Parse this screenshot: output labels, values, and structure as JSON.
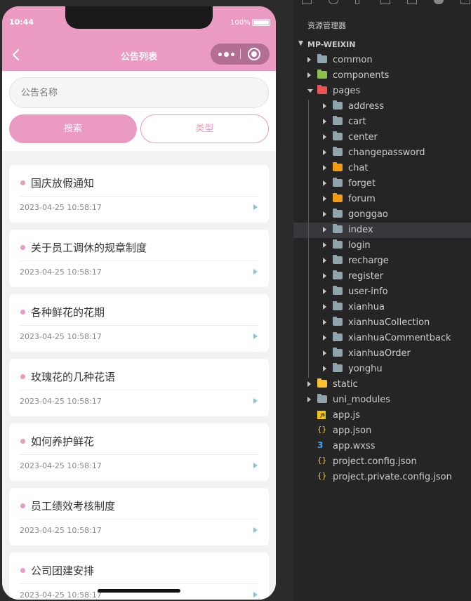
{
  "phone": {
    "status": {
      "time": "10:44",
      "battery": "100%"
    },
    "nav": {
      "title": "公告列表"
    },
    "search": {
      "placeholder": "公告名称",
      "search_label": "搜索",
      "type_label": "类型"
    },
    "notices": [
      {
        "title": "国庆放假通知",
        "date": "2023-04-25 10:58:17"
      },
      {
        "title": "关于员工调休的规章制度",
        "date": "2023-04-25 10:58:17"
      },
      {
        "title": "各种鲜花的花期",
        "date": "2023-04-25 10:58:17"
      },
      {
        "title": "玫瑰花的几种花语",
        "date": "2023-04-25 10:58:17"
      },
      {
        "title": "如何养护鲜花",
        "date": "2023-04-25 10:58:17"
      },
      {
        "title": "员工绩效考核制度",
        "date": "2023-04-25 10:58:17"
      },
      {
        "title": "公司团建安排",
        "date": "2023-04-25 10:58:17"
      }
    ],
    "colors": {
      "accent": "#eb9ac1",
      "arrow": "#7fc8d6"
    }
  },
  "explorer": {
    "header": "资源管理器",
    "project": "MP-WEIXIN",
    "tree": [
      {
        "label": "common",
        "type": "folder",
        "icon": "folder-grey-icon"
      },
      {
        "label": "components",
        "type": "folder",
        "icon": "folder-green-icon"
      },
      {
        "label": "pages",
        "type": "folder-open",
        "icon": "folder-red-icon"
      },
      {
        "label": "address",
        "type": "folder",
        "icon": "folder-grey-icon"
      },
      {
        "label": "cart",
        "type": "folder",
        "icon": "folder-grey-icon"
      },
      {
        "label": "center",
        "type": "folder",
        "icon": "folder-grey-icon"
      },
      {
        "label": "changepassword",
        "type": "folder",
        "icon": "folder-grey-icon"
      },
      {
        "label": "chat",
        "type": "folder",
        "icon": "folder-orange-icon"
      },
      {
        "label": "forget",
        "type": "folder",
        "icon": "folder-grey-icon"
      },
      {
        "label": "forum",
        "type": "folder",
        "icon": "folder-orange-icon"
      },
      {
        "label": "gonggao",
        "type": "folder",
        "icon": "folder-grey-icon"
      },
      {
        "label": "index",
        "type": "folder",
        "icon": "folder-grey-icon",
        "selected": true
      },
      {
        "label": "login",
        "type": "folder",
        "icon": "folder-grey-icon"
      },
      {
        "label": "recharge",
        "type": "folder",
        "icon": "folder-grey-icon"
      },
      {
        "label": "register",
        "type": "folder",
        "icon": "folder-grey-icon"
      },
      {
        "label": "user-info",
        "type": "folder",
        "icon": "folder-grey-icon"
      },
      {
        "label": "xianhua",
        "type": "folder",
        "icon": "folder-grey-icon"
      },
      {
        "label": "xianhuaCollection",
        "type": "folder",
        "icon": "folder-grey-icon"
      },
      {
        "label": "xianhuaCommentback",
        "type": "folder",
        "icon": "folder-grey-icon"
      },
      {
        "label": "xianhuaOrder",
        "type": "folder",
        "icon": "folder-grey-icon"
      },
      {
        "label": "yonghu",
        "type": "folder",
        "icon": "folder-grey-icon"
      },
      {
        "label": "static",
        "type": "folder",
        "icon": "folder-yellow-icon"
      },
      {
        "label": "uni_modules",
        "type": "folder",
        "icon": "folder-grey-icon"
      },
      {
        "label": "app.js",
        "type": "file",
        "icon": "js-file-icon"
      },
      {
        "label": "app.json",
        "type": "file",
        "icon": "json-file-icon"
      },
      {
        "label": "app.wxss",
        "type": "file",
        "icon": "css-file-icon"
      },
      {
        "label": "project.config.json",
        "type": "file",
        "icon": "json-file-icon"
      },
      {
        "label": "project.private.config.json",
        "type": "file",
        "icon": "json-file-icon"
      }
    ]
  }
}
